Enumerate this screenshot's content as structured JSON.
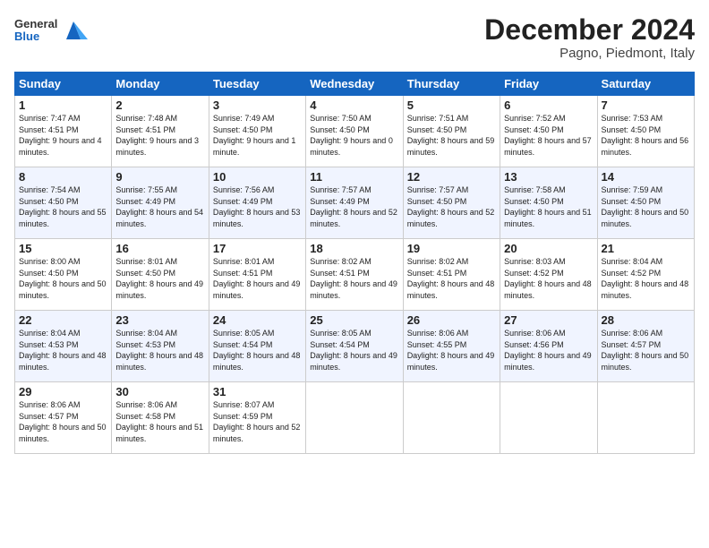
{
  "header": {
    "logo_general": "General",
    "logo_blue": "Blue",
    "month_title": "December 2024",
    "location": "Pagno, Piedmont, Italy"
  },
  "days_of_week": [
    "Sunday",
    "Monday",
    "Tuesday",
    "Wednesday",
    "Thursday",
    "Friday",
    "Saturday"
  ],
  "weeks": [
    [
      {
        "day": "1",
        "sunrise": "7:47 AM",
        "sunset": "4:51 PM",
        "daylight": "9 hours and 4 minutes."
      },
      {
        "day": "2",
        "sunrise": "7:48 AM",
        "sunset": "4:51 PM",
        "daylight": "9 hours and 3 minutes."
      },
      {
        "day": "3",
        "sunrise": "7:49 AM",
        "sunset": "4:50 PM",
        "daylight": "9 hours and 1 minute."
      },
      {
        "day": "4",
        "sunrise": "7:50 AM",
        "sunset": "4:50 PM",
        "daylight": "9 hours and 0 minutes."
      },
      {
        "day": "5",
        "sunrise": "7:51 AM",
        "sunset": "4:50 PM",
        "daylight": "8 hours and 59 minutes."
      },
      {
        "day": "6",
        "sunrise": "7:52 AM",
        "sunset": "4:50 PM",
        "daylight": "8 hours and 57 minutes."
      },
      {
        "day": "7",
        "sunrise": "7:53 AM",
        "sunset": "4:50 PM",
        "daylight": "8 hours and 56 minutes."
      }
    ],
    [
      {
        "day": "8",
        "sunrise": "7:54 AM",
        "sunset": "4:50 PM",
        "daylight": "8 hours and 55 minutes."
      },
      {
        "day": "9",
        "sunrise": "7:55 AM",
        "sunset": "4:49 PM",
        "daylight": "8 hours and 54 minutes."
      },
      {
        "day": "10",
        "sunrise": "7:56 AM",
        "sunset": "4:49 PM",
        "daylight": "8 hours and 53 minutes."
      },
      {
        "day": "11",
        "sunrise": "7:57 AM",
        "sunset": "4:49 PM",
        "daylight": "8 hours and 52 minutes."
      },
      {
        "day": "12",
        "sunrise": "7:57 AM",
        "sunset": "4:50 PM",
        "daylight": "8 hours and 52 minutes."
      },
      {
        "day": "13",
        "sunrise": "7:58 AM",
        "sunset": "4:50 PM",
        "daylight": "8 hours and 51 minutes."
      },
      {
        "day": "14",
        "sunrise": "7:59 AM",
        "sunset": "4:50 PM",
        "daylight": "8 hours and 50 minutes."
      }
    ],
    [
      {
        "day": "15",
        "sunrise": "8:00 AM",
        "sunset": "4:50 PM",
        "daylight": "8 hours and 50 minutes."
      },
      {
        "day": "16",
        "sunrise": "8:01 AM",
        "sunset": "4:50 PM",
        "daylight": "8 hours and 49 minutes."
      },
      {
        "day": "17",
        "sunrise": "8:01 AM",
        "sunset": "4:51 PM",
        "daylight": "8 hours and 49 minutes."
      },
      {
        "day": "18",
        "sunrise": "8:02 AM",
        "sunset": "4:51 PM",
        "daylight": "8 hours and 49 minutes."
      },
      {
        "day": "19",
        "sunrise": "8:02 AM",
        "sunset": "4:51 PM",
        "daylight": "8 hours and 48 minutes."
      },
      {
        "day": "20",
        "sunrise": "8:03 AM",
        "sunset": "4:52 PM",
        "daylight": "8 hours and 48 minutes."
      },
      {
        "day": "21",
        "sunrise": "8:04 AM",
        "sunset": "4:52 PM",
        "daylight": "8 hours and 48 minutes."
      }
    ],
    [
      {
        "day": "22",
        "sunrise": "8:04 AM",
        "sunset": "4:53 PM",
        "daylight": "8 hours and 48 minutes."
      },
      {
        "day": "23",
        "sunrise": "8:04 AM",
        "sunset": "4:53 PM",
        "daylight": "8 hours and 48 minutes."
      },
      {
        "day": "24",
        "sunrise": "8:05 AM",
        "sunset": "4:54 PM",
        "daylight": "8 hours and 48 minutes."
      },
      {
        "day": "25",
        "sunrise": "8:05 AM",
        "sunset": "4:54 PM",
        "daylight": "8 hours and 49 minutes."
      },
      {
        "day": "26",
        "sunrise": "8:06 AM",
        "sunset": "4:55 PM",
        "daylight": "8 hours and 49 minutes."
      },
      {
        "day": "27",
        "sunrise": "8:06 AM",
        "sunset": "4:56 PM",
        "daylight": "8 hours and 49 minutes."
      },
      {
        "day": "28",
        "sunrise": "8:06 AM",
        "sunset": "4:57 PM",
        "daylight": "8 hours and 50 minutes."
      }
    ],
    [
      {
        "day": "29",
        "sunrise": "8:06 AM",
        "sunset": "4:57 PM",
        "daylight": "8 hours and 50 minutes."
      },
      {
        "day": "30",
        "sunrise": "8:06 AM",
        "sunset": "4:58 PM",
        "daylight": "8 hours and 51 minutes."
      },
      {
        "day": "31",
        "sunrise": "8:07 AM",
        "sunset": "4:59 PM",
        "daylight": "8 hours and 52 minutes."
      },
      null,
      null,
      null,
      null
    ]
  ]
}
